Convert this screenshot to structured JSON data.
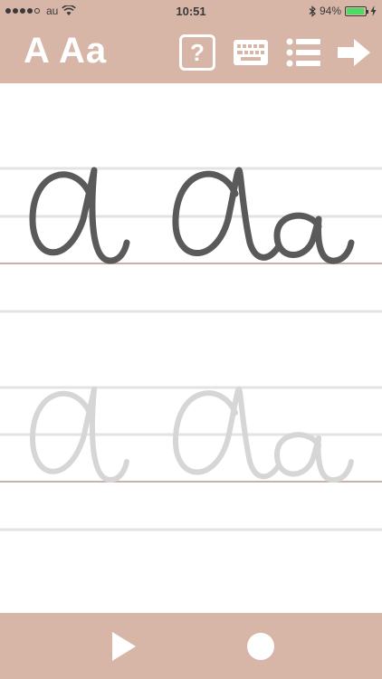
{
  "status_bar": {
    "carrier": "au",
    "time": "10:51",
    "battery_percent": "94%",
    "battery_level": 0.94
  },
  "toolbar": {
    "title": "A Aa",
    "help_label": "?",
    "keyboard_icon": "keyboard-icon",
    "list_icon": "list-icon",
    "next_icon": "arrow-right-icon"
  },
  "colors": {
    "bar": "#d7b6a8",
    "guide_line": "#e3e3e3",
    "base_line": "#c9b1a6",
    "letter_dark": "#5a5a5a",
    "letter_light": "#d6d6d6"
  },
  "writing": {
    "model_letters": "a Aa",
    "trace_letters": "a Aa"
  },
  "bottom_bar": {
    "play_icon": "play-icon",
    "record_icon": "record-icon"
  }
}
